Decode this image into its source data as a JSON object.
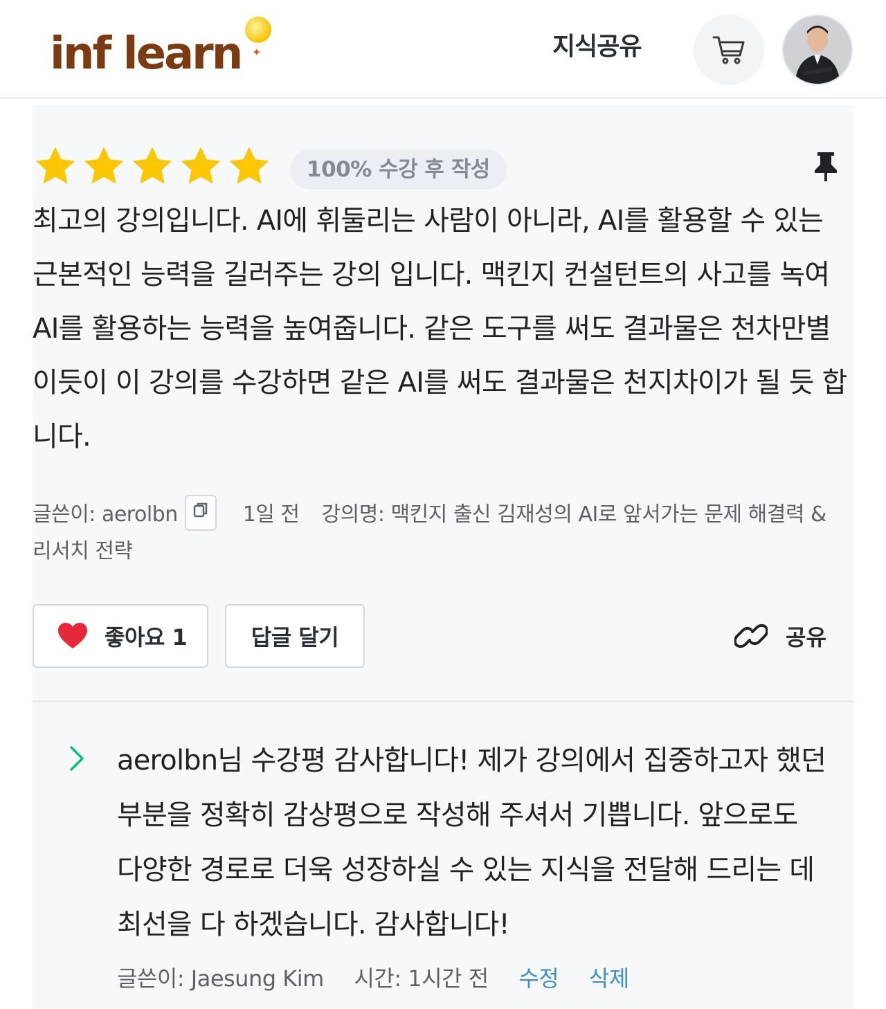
{
  "header": {
    "logo_text": "inf learn",
    "nav_knowledge": "지식공유",
    "cart_icon": "cart-icon",
    "avatar": "user-avatar"
  },
  "review": {
    "rating": 5,
    "rating_max": 5,
    "star_color": "#fbc700",
    "badge": "100% 수강 후 작성",
    "pin_icon": "pin-icon",
    "body": "최고의 강의입니다. AI에 휘둘리는 사람이 아니라, AI를 활용할 수 있는 근본적인 능력을 길러주는 강의 입니다. 맥킨지 컨설턴트의 사고를 녹여 AI를 활용하는 능력을 높여줍니다. 같은 도구를 써도 결과물은 천차만별 이듯이 이 강의를 수강하면 같은 AI를 써도 결과물은 천지차이가 될 듯 합니다.",
    "author_label": "글쓴이: aerolbn",
    "date": "1일 전",
    "course_label": "강의명: 맥킨지 출신 김재성의 AI로 앞서가는 문제 해결력 & 리서치 전략",
    "like_label": "좋아요 1",
    "reply_label": "답글 달기",
    "share_label": "공유",
    "heart_color": "#e5293b"
  },
  "reply": {
    "body": "aerolbn님 수강평 감사합니다! 제가 강의에서 집중하고자 했던 부분을 정확히 감상평으로 작성해 주셔서 기쁩니다. 앞으로도 다양한 경로로 더욱 성장하실 수 있는 지식을 전달해 드리는 데 최선을 다 하겠습니다. 감사합니다!",
    "author_label": "글쓴이: Jaesung Kim",
    "time_label": "시간: 1시간 전",
    "edit_label": "수정",
    "delete_label": "삭제",
    "link_color": "#3f8fcf",
    "chevron_color": "#00c471"
  }
}
